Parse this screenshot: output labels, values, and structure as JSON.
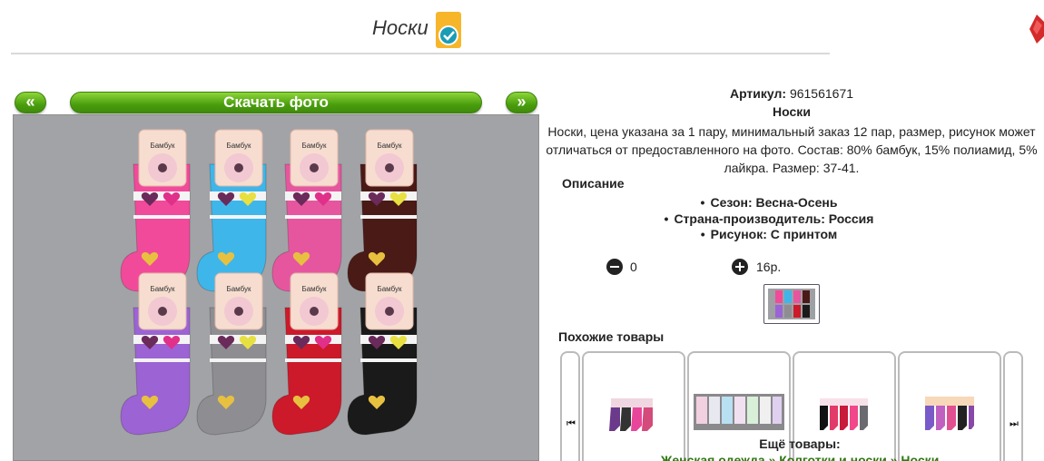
{
  "header": {
    "title": "Носки"
  },
  "gallery": {
    "prev_label": "«",
    "next_label": "»",
    "download_label": "Скачать фото",
    "label_text": "Бамбук",
    "sock_colors": [
      "#f24a9a",
      "#3fb6ea",
      "#e6569f",
      "#4a1a16",
      "#9c63d4",
      "#8e8e92",
      "#cc1a2a",
      "#1a1a1a"
    ]
  },
  "product": {
    "article_label": "Артикул:",
    "article_value": "961561671",
    "name": "Носки",
    "description": "Носки, цена указана за 1 пару, минимальный заказ 12 пар, размер, рисунок может отличаться от предоставленного на фото. Состав: 80% бамбук, 15% полиамид, 5% лайкра. Размер: 37-41.",
    "desc_heading": "Описание",
    "specs": [
      "Сезон: Весна-Осень",
      "Страна-производитель: Россия",
      "Рисунок: С принтом"
    ],
    "quantity": "0",
    "price": "16р."
  },
  "similar": {
    "heading": "Похожие товары",
    "left_arrow": "⏮",
    "right_arrow": "⏭"
  },
  "more": {
    "heading": "Ещё товары:",
    "breadcrumb": [
      "Женская одежда",
      "Колготки и носки",
      "Носки"
    ],
    "separator": "»"
  }
}
